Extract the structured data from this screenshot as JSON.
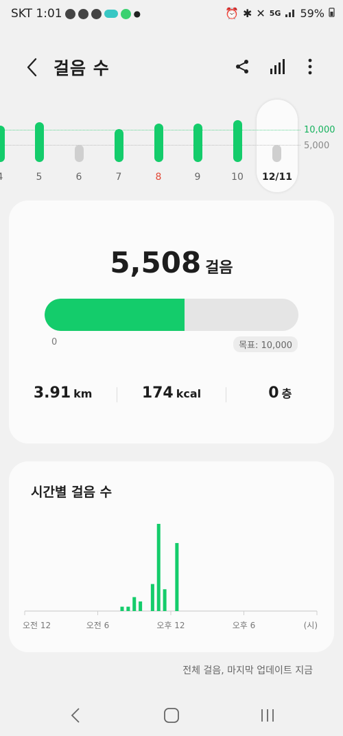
{
  "status": {
    "carrier_time": "SKT 1:01",
    "network": "5G",
    "battery": "59%"
  },
  "header": {
    "title": "걸음 수",
    "share_icon": "share-icon",
    "stats_icon": "bar-chart-icon",
    "more_icon": "more-vert-icon"
  },
  "week": {
    "days": [
      {
        "label": "4",
        "level": 0.85,
        "red": false
      },
      {
        "label": "5",
        "level": 0.93,
        "red": false
      },
      {
        "label": "6",
        "level": 0.4,
        "red": false,
        "low": true
      },
      {
        "label": "7",
        "level": 0.77,
        "red": false
      },
      {
        "label": "8",
        "level": 0.9,
        "red": true
      },
      {
        "label": "9",
        "level": 0.9,
        "red": false
      },
      {
        "label": "10",
        "level": 0.98,
        "red": false
      }
    ],
    "today_label": "12/11",
    "today_level": 0.45,
    "goal_label": "10,000",
    "half_label": "5,000",
    "green": "#14cc6b"
  },
  "summary": {
    "steps": "5,508",
    "steps_unit": "걸음",
    "progress": 0.5508,
    "zero": "0",
    "goal": "목표: 10,000",
    "distance": "3.91",
    "distance_unit": "km",
    "calories": "174",
    "calories_unit": "kcal",
    "floors": "0",
    "floors_unit": "층"
  },
  "hourly": {
    "title": "시간별 걸음 수",
    "axis_labels": [
      "오전 12",
      "오전 6",
      "오후 12",
      "오후 6",
      "(시)"
    ],
    "bars": [
      {
        "hour": 8.0,
        "value": 0.05
      },
      {
        "hour": 8.5,
        "value": 0.05
      },
      {
        "hour": 9.0,
        "value": 0.16
      },
      {
        "hour": 9.5,
        "value": 0.11
      },
      {
        "hour": 10.5,
        "value": 0.31
      },
      {
        "hour": 11.0,
        "value": 1.0
      },
      {
        "hour": 11.5,
        "value": 0.25
      },
      {
        "hour": 12.5,
        "value": 0.78
      }
    ]
  },
  "footer": {
    "note": "전체 걸음, 마지막 업데이트 지금"
  },
  "nav": {
    "back_icon": "back-nav-icon",
    "home_icon": "home-nav-icon",
    "recents_icon": "recents-nav-icon"
  }
}
